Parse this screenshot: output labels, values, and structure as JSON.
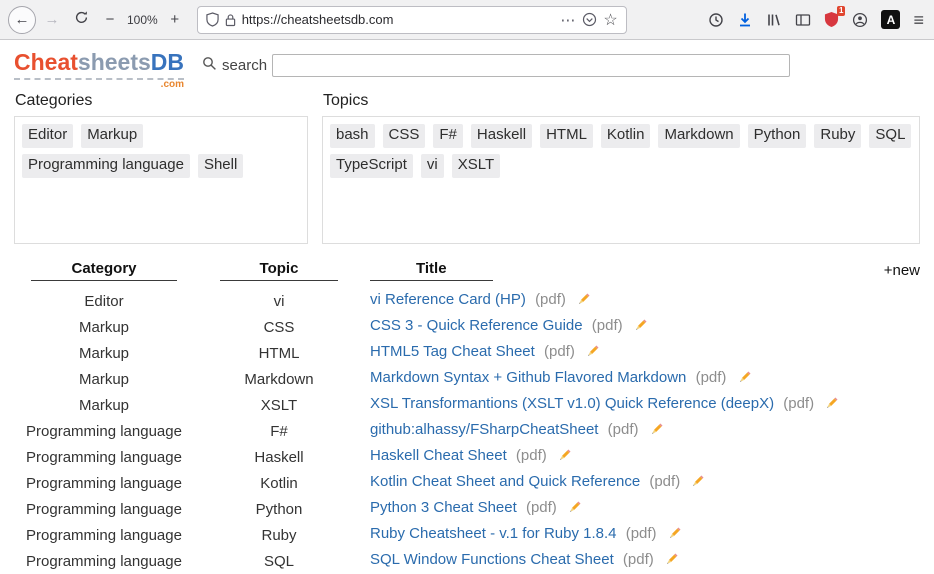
{
  "browser": {
    "url": "https://cheatsheetsdb.com",
    "zoom_level": "100%",
    "extension_badge": "1",
    "extension_a_label": "A",
    "icons": {
      "back": "←",
      "forward": "→",
      "zoom_out": "−",
      "zoom_in": "+",
      "page_actions": "⋯",
      "bookmark_star": "☆",
      "menu": "≡"
    }
  },
  "page": {
    "logo": {
      "cheat": "Cheat",
      "sheets": "sheets",
      "db": "DB",
      "tld": ".com"
    },
    "search_label": "search",
    "search_value": "",
    "categories": {
      "label": "Categories",
      "items": [
        "Editor",
        "Markup",
        "Programming language",
        "Shell"
      ]
    },
    "topics": {
      "label": "Topics",
      "items": [
        "bash",
        "CSS",
        "F#",
        "Haskell",
        "HTML",
        "Kotlin",
        "Markdown",
        "Python",
        "Ruby",
        "SQL",
        "TypeScript",
        "vi",
        "XSLT"
      ]
    },
    "table": {
      "headers": {
        "category": "Category",
        "topic": "Topic",
        "title": "Title"
      },
      "new_label": "+new",
      "pdf_suffix": "(pdf)",
      "rows": [
        {
          "category": "Editor",
          "topic": "vi",
          "title": "vi Reference Card (HP)"
        },
        {
          "category": "Markup",
          "topic": "CSS",
          "title": "CSS 3 - Quick Reference Guide"
        },
        {
          "category": "Markup",
          "topic": "HTML",
          "title": "HTML5 Tag Cheat Sheet"
        },
        {
          "category": "Markup",
          "topic": "Markdown",
          "title": "Markdown Syntax + Github Flavored Markdown"
        },
        {
          "category": "Markup",
          "topic": "XSLT",
          "title": "XSL Transformantions (XSLT v1.0) Quick Reference (deepX)"
        },
        {
          "category": "Programming language",
          "topic": "F#",
          "title": "github:alhassy/FSharpCheatSheet"
        },
        {
          "category": "Programming language",
          "topic": "Haskell",
          "title": "Haskell Cheat Sheet"
        },
        {
          "category": "Programming language",
          "topic": "Kotlin",
          "title": "Kotlin Cheat Sheet and Quick Reference"
        },
        {
          "category": "Programming language",
          "topic": "Python",
          "title": "Python 3 Cheat Sheet"
        },
        {
          "category": "Programming language",
          "topic": "Ruby",
          "title": "Ruby Cheatsheet - v.1 for Ruby 1.8.4"
        },
        {
          "category": "Programming language",
          "topic": "SQL",
          "title": "SQL Window Functions Cheat Sheet"
        }
      ]
    }
  }
}
